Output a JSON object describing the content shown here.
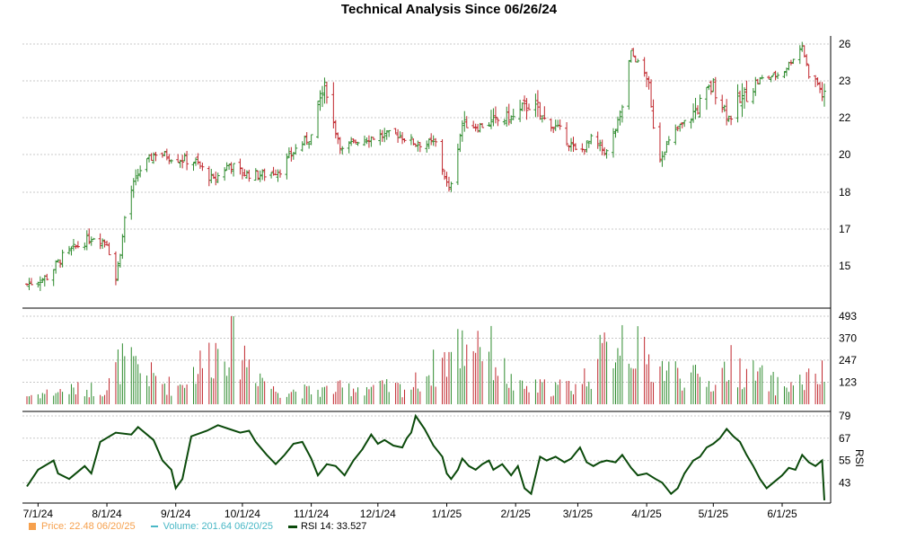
{
  "chart_data": {
    "type": "candlestick",
    "title": "Technical Analysis Since 06/26/24",
    "x_tick_labels": [
      "7/1/24",
      "8/1/24",
      "9/1/24",
      "10/1/24",
      "11/1/24",
      "12/1/24",
      "1/1/25",
      "2/1/25",
      "3/1/25",
      "4/1/25",
      "5/1/25",
      "6/1/25"
    ],
    "colors": {
      "up": "#2e8b2e",
      "down": "#c0272d",
      "grid": "#c8c8c8",
      "rsi_line": "#0b4a0b",
      "price_legend": "#f6a04d",
      "volume_legend": "#4ab8c6"
    },
    "panels": [
      {
        "name": "price",
        "y_ticks": [
          15,
          17,
          18,
          20,
          22,
          23,
          26
        ],
        "approx_close_series": [
          [
            "2024-06-26",
            14.0
          ],
          [
            "2024-07-05",
            14.4
          ],
          [
            "2024-07-12",
            15.5
          ],
          [
            "2024-07-19",
            16.1
          ],
          [
            "2024-07-26",
            16.6
          ],
          [
            "2024-08-01",
            16.3
          ],
          [
            "2024-08-05",
            14.3
          ],
          [
            "2024-08-09",
            17.3
          ],
          [
            "2024-08-16",
            19.2
          ],
          [
            "2024-08-23",
            20.1
          ],
          [
            "2024-09-01",
            19.8
          ],
          [
            "2024-09-10",
            19.6
          ],
          [
            "2024-09-18",
            18.6
          ],
          [
            "2024-09-25",
            19.5
          ],
          [
            "2024-10-01",
            19.0
          ],
          [
            "2024-10-10",
            18.9
          ],
          [
            "2024-10-18",
            19.2
          ],
          [
            "2024-10-25",
            20.3
          ],
          [
            "2024-11-01",
            21.0
          ],
          [
            "2024-11-05",
            22.6
          ],
          [
            "2024-11-08",
            22.8
          ],
          [
            "2024-11-15",
            20.2
          ],
          [
            "2024-11-22",
            20.8
          ],
          [
            "2024-12-01",
            21.0
          ],
          [
            "2024-12-10",
            21.1
          ],
          [
            "2024-12-18",
            20.6
          ],
          [
            "2024-12-27",
            20.6
          ],
          [
            "2025-01-02",
            18.0
          ],
          [
            "2025-01-08",
            21.7
          ],
          [
            "2025-01-15",
            21.5
          ],
          [
            "2025-01-22",
            21.8
          ],
          [
            "2025-02-01",
            22.0
          ],
          [
            "2025-02-07",
            22.4
          ],
          [
            "2025-02-14",
            21.9
          ],
          [
            "2025-02-21",
            21.3
          ],
          [
            "2025-03-01",
            20.0
          ],
          [
            "2025-03-07",
            20.8
          ],
          [
            "2025-03-14",
            20.1
          ],
          [
            "2025-03-21",
            22.3
          ],
          [
            "2025-03-25",
            25.3
          ],
          [
            "2025-04-01",
            23.3
          ],
          [
            "2025-04-07",
            19.9
          ],
          [
            "2025-04-15",
            21.4
          ],
          [
            "2025-04-22",
            22.1
          ],
          [
            "2025-05-01",
            22.9
          ],
          [
            "2025-05-08",
            22.0
          ],
          [
            "2025-05-15",
            22.6
          ],
          [
            "2025-05-22",
            23.1
          ],
          [
            "2025-06-01",
            23.6
          ],
          [
            "2025-06-10",
            25.9
          ],
          [
            "2025-06-13",
            23.5
          ],
          [
            "2025-06-20",
            22.5
          ]
        ]
      },
      {
        "name": "volume",
        "y_ticks": [
          123,
          247,
          370,
          493
        ],
        "approx_series": [
          [
            "2024-06-26",
            60
          ],
          [
            "2024-07-15",
            100
          ],
          [
            "2024-08-01",
            110
          ],
          [
            "2024-08-07",
            300
          ],
          [
            "2024-09-01",
            110
          ],
          [
            "2024-09-25",
            470
          ],
          [
            "2024-10-15",
            100
          ],
          [
            "2024-11-01",
            90
          ],
          [
            "2024-11-22",
            120
          ],
          [
            "2024-12-15",
            110
          ],
          [
            "2025-01-02",
            340
          ],
          [
            "2025-01-15",
            490
          ],
          [
            "2025-02-01",
            110
          ],
          [
            "2025-03-01",
            130
          ],
          [
            "2025-03-21",
            500
          ],
          [
            "2025-04-01",
            290
          ],
          [
            "2025-04-07",
            260
          ],
          [
            "2025-05-01",
            140
          ],
          [
            "2025-05-08",
            280
          ],
          [
            "2025-06-01",
            120
          ],
          [
            "2025-06-20",
            201.64
          ]
        ]
      },
      {
        "name": "rsi",
        "y_label": "RSI",
        "y_ticks": [
          43,
          55,
          67,
          79
        ],
        "series": [
          [
            "2024-06-26",
            41
          ],
          [
            "2024-07-01",
            50
          ],
          [
            "2024-07-08",
            55
          ],
          [
            "2024-07-10",
            48
          ],
          [
            "2024-07-15",
            45
          ],
          [
            "2024-07-22",
            52
          ],
          [
            "2024-07-25",
            48
          ],
          [
            "2024-07-29",
            65
          ],
          [
            "2024-08-05",
            70
          ],
          [
            "2024-08-12",
            69
          ],
          [
            "2024-08-15",
            73
          ],
          [
            "2024-08-22",
            66
          ],
          [
            "2024-08-26",
            55
          ],
          [
            "2024-08-30",
            50
          ],
          [
            "2024-09-01",
            40
          ],
          [
            "2024-09-04",
            45
          ],
          [
            "2024-09-08",
            68
          ],
          [
            "2024-09-15",
            71
          ],
          [
            "2024-09-20",
            74
          ],
          [
            "2024-09-25",
            72
          ],
          [
            "2024-09-30",
            70
          ],
          [
            "2024-10-04",
            71
          ],
          [
            "2024-10-07",
            65
          ],
          [
            "2024-10-12",
            58
          ],
          [
            "2024-10-16",
            53
          ],
          [
            "2024-10-20",
            58
          ],
          [
            "2024-10-24",
            64
          ],
          [
            "2024-10-28",
            65
          ],
          [
            "2024-11-01",
            56
          ],
          [
            "2024-11-04",
            47
          ],
          [
            "2024-11-08",
            53
          ],
          [
            "2024-11-12",
            52
          ],
          [
            "2024-11-16",
            47
          ],
          [
            "2024-11-20",
            55
          ],
          [
            "2024-11-24",
            61
          ],
          [
            "2024-11-28",
            69
          ],
          [
            "2024-12-01",
            64
          ],
          [
            "2024-12-04",
            66
          ],
          [
            "2024-12-08",
            63
          ],
          [
            "2024-12-12",
            62
          ],
          [
            "2024-12-14",
            67
          ],
          [
            "2024-12-16",
            70
          ],
          [
            "2024-12-18",
            79
          ],
          [
            "2024-12-22",
            72
          ],
          [
            "2024-12-26",
            63
          ],
          [
            "2024-12-30",
            57
          ],
          [
            "2025-01-01",
            48
          ],
          [
            "2025-01-03",
            45
          ],
          [
            "2025-01-06",
            50
          ],
          [
            "2025-01-08",
            56
          ],
          [
            "2025-01-11",
            52
          ],
          [
            "2025-01-14",
            50
          ],
          [
            "2025-01-17",
            53
          ],
          [
            "2025-01-20",
            55
          ],
          [
            "2025-01-22",
            50
          ],
          [
            "2025-01-26",
            53
          ],
          [
            "2025-01-30",
            47
          ],
          [
            "2025-02-02",
            52
          ],
          [
            "2025-02-05",
            40
          ],
          [
            "2025-02-08",
            37
          ],
          [
            "2025-02-12",
            57
          ],
          [
            "2025-02-15",
            55
          ],
          [
            "2025-02-19",
            57
          ],
          [
            "2025-02-23",
            54
          ],
          [
            "2025-02-26",
            56
          ],
          [
            "2025-03-02",
            62
          ],
          [
            "2025-03-05",
            54
          ],
          [
            "2025-03-08",
            52
          ],
          [
            "2025-03-11",
            54
          ],
          [
            "2025-03-14",
            55
          ],
          [
            "2025-03-18",
            54
          ],
          [
            "2025-03-21",
            58
          ],
          [
            "2025-03-25",
            51
          ],
          [
            "2025-03-28",
            47
          ],
          [
            "2025-04-01",
            48
          ],
          [
            "2025-04-05",
            45
          ],
          [
            "2025-04-08",
            43
          ],
          [
            "2025-04-12",
            37
          ],
          [
            "2025-04-15",
            40
          ],
          [
            "2025-04-18",
            48
          ],
          [
            "2025-04-22",
            55
          ],
          [
            "2025-04-25",
            57
          ],
          [
            "2025-04-28",
            62
          ],
          [
            "2025-05-01",
            64
          ],
          [
            "2025-05-04",
            67
          ],
          [
            "2025-05-07",
            72
          ],
          [
            "2025-05-10",
            68
          ],
          [
            "2025-05-13",
            65
          ],
          [
            "2025-05-16",
            58
          ],
          [
            "2025-05-19",
            52
          ],
          [
            "2025-05-22",
            45
          ],
          [
            "2025-05-25",
            40
          ],
          [
            "2025-05-28",
            43
          ],
          [
            "2025-06-01",
            47
          ],
          [
            "2025-06-04",
            51
          ],
          [
            "2025-06-07",
            50
          ],
          [
            "2025-06-10",
            58
          ],
          [
            "2025-06-13",
            54
          ],
          [
            "2025-06-16",
            52
          ],
          [
            "2025-06-19",
            55
          ],
          [
            "2025-06-20",
            33.527
          ]
        ]
      }
    ]
  },
  "legend": {
    "price": "Price: 22.48  06/20/25",
    "volume": "Volume: 201.64  06/20/25",
    "rsi": "RSI 14: 33.527"
  }
}
